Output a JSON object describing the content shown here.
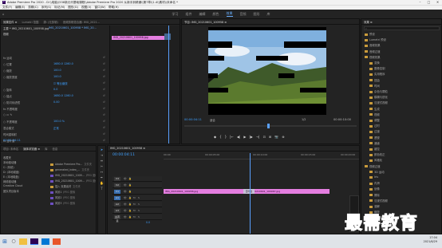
{
  "window": {
    "title": "Adobe Premiere Pro 2020 - D:\\\\电脑\\\\538新元代基础课程\\\\Adobe Premiere Pro 2020 从新手到精通\\\\第7章\\\\1.4\\\\素材\\\\未命名 *",
    "controls": [
      "–",
      "□",
      "✕"
    ]
  },
  "menu": [
    "文件(F)",
    "编辑(E)",
    "剪辑(C)",
    "序列(S)",
    "标记(M)",
    "图形(G)",
    "视图(V)",
    "窗口(W)",
    "帮助(H)"
  ],
  "workspaces": [
    "学习",
    "组件",
    "编辑",
    "颜色",
    "效果",
    "音频",
    "图形",
    "库"
  ],
  "active_workspace": "效果",
  "effect_controls": {
    "tabs": [
      "效果控件 ≡",
      "Lumetri 范围",
      "源: (无剪辑)",
      "音频剪辑混合器: IMG_2021..."
    ],
    "source_label": "主要 * IMG_20210601_100958.jpg",
    "sequence_label": "IMG_20210601_100958 * IMG_20...",
    "clip_label": "IMG_20210601_100958.jpg",
    "video_header": "视频",
    "rows": [
      {
        "label": "fx  运动",
        "value": ""
      },
      {
        "label": "  ○ 位置",
        "value": "1680.0    1260.0"
      },
      {
        "label": "  ○ 缩放",
        "value": "100.0"
      },
      {
        "label": "  ○ 缩放宽度",
        "value": "100.0"
      },
      {
        "label": "",
        "value": "☑ 等比缩放"
      },
      {
        "label": "  ○ 旋转",
        "value": "0.0"
      },
      {
        "label": "  ○ 锚点",
        "value": "1680.0    1260.0"
      },
      {
        "label": "  ○ 防闪烁滤镜",
        "value": "0.00"
      },
      {
        "label": "fx  不透明度",
        "value": ""
      },
      {
        "label": "  ○ ▭ ✎",
        "value": ""
      },
      {
        "label": "  ○ 不透明度",
        "value": "100.0 %"
      },
      {
        "label": "  混合模式",
        "value": "正常"
      },
      {
        "label": "  时间重映射",
        "value": ""
      },
      {
        "label": "fx  百叶窗",
        "value": ""
      },
      {
        "label": "  ○ 过渡完成",
        "value": "0 %"
      },
      {
        "label": "  ○ 方向",
        "value": "90.0"
      }
    ],
    "timecode": "00:00:04:11"
  },
  "program_monitor": {
    "tab": "节目: IMG_20210601_100958 ≡",
    "timecode": "00:00:04:11",
    "fit": "适合",
    "ratio": "1/2",
    "duration": "00:00:10:00",
    "controls": [
      "◆",
      "{",
      "}",
      "|←",
      "◀|",
      "▶",
      "|▶",
      "→|",
      "⊡",
      "⊞",
      "📷",
      "⊕"
    ]
  },
  "effects_panel": {
    "tab": "效果 ≡",
    "items": [
      {
        "label": "预设",
        "indent": 0
      },
      {
        "label": "Lumetri 预设",
        "indent": 0
      },
      {
        "label": "音频效果",
        "indent": 0
      },
      {
        "label": "音频过渡",
        "indent": 0
      },
      {
        "label": "视频效果",
        "indent": 0
      },
      {
        "label": "变换",
        "indent": 1
      },
      {
        "label": "图像控制",
        "indent": 1
      },
      {
        "label": "实用程序",
        "indent": 1
      },
      {
        "label": "扭曲",
        "indent": 1
      },
      {
        "label": "时间",
        "indent": 1
      },
      {
        "label": "杂色与颗粒",
        "indent": 1
      },
      {
        "label": "模糊与锐化",
        "indent": 1
      },
      {
        "label": "沉浸式视频",
        "indent": 1
      },
      {
        "label": "生成",
        "indent": 1
      },
      {
        "label": "视频",
        "indent": 1
      },
      {
        "label": "调整",
        "indent": 1
      },
      {
        "label": "过时",
        "indent": 1
      },
      {
        "label": "过渡",
        "indent": 1
      },
      {
        "label": "透视",
        "indent": 1
      },
      {
        "label": "通道",
        "indent": 1
      },
      {
        "label": "键控",
        "indent": 1
      },
      {
        "label": "颜色校正",
        "indent": 1
      },
      {
        "label": "风格化",
        "indent": 1
      },
      {
        "label": "视频过渡",
        "indent": 0
      },
      {
        "label": "3D 运动",
        "indent": 1
      },
      {
        "label": "Iris",
        "indent": 1
      },
      {
        "label": "内滑",
        "indent": 1
      },
      {
        "label": "划像",
        "indent": 1
      },
      {
        "label": "擦除",
        "indent": 1
      },
      {
        "label": "沉浸式视频",
        "indent": 1
      },
      {
        "label": "溶解",
        "indent": 1
      },
      {
        "label": "缩放",
        "indent": 1
      },
      {
        "label": "页面剥落",
        "indent": 1
      }
    ]
  },
  "project_panel": {
    "tabs": [
      "项目: 未命名",
      "媒体浏览器 ≡",
      "库",
      "信息"
    ],
    "left_items": [
      "收藏夹",
      "本地驱动器",
      "C: (系统)",
      "D: (本地磁盘)",
      "E: (本地磁盘)",
      "网络驱动器",
      "Creative Cloud",
      "团队项目版本"
    ],
    "files": [
      {
        "name": "Adobe Premiere Pro...",
        "type": "文件夹"
      },
      {
        "name": "generated_index_...",
        "type": "文件夹"
      },
      {
        "name": "IMG_20210601_1009...",
        "type": "JPEG 图像"
      },
      {
        "name": "IMG_20210601_1009...",
        "type": "JPEG 图像"
      },
      {
        "name": "插入 效果素材",
        "type": "文件夹"
      },
      {
        "name": "风景1",
        "type": "JPEG 图像"
      },
      {
        "name": "风景2",
        "type": "JPEG 图像"
      },
      {
        "name": "风景3",
        "type": "JPEG 图像"
      }
    ]
  },
  "timeline": {
    "tab": "IMG_20210601_100958 ≡",
    "timecode": "00:00:04:11",
    "ruler": [
      "00:00",
      "00:00:05:00",
      "00:00:10:00",
      "00:00:15:00",
      "00:00:20:00"
    ],
    "tracks": [
      "V3",
      "V2",
      "V1",
      "A1",
      "A2",
      "A3",
      "主声道"
    ],
    "master_value": "0.0",
    "clip1": "IMG_20210601_100958.jpg",
    "clip2": "IMG_20210601_100967.jpg",
    "transition": "百叶窗"
  },
  "watermark": "最需教育",
  "taskbar": {
    "time": "17:04",
    "date": "2021/6/29",
    "start_icon": "⊞",
    "search_icon": "○"
  },
  "colors": {
    "accent": "#3ea0ff",
    "clip": "#e47ee0",
    "playhead": "#5aa0ff",
    "watermark": "#0f2d8c"
  }
}
